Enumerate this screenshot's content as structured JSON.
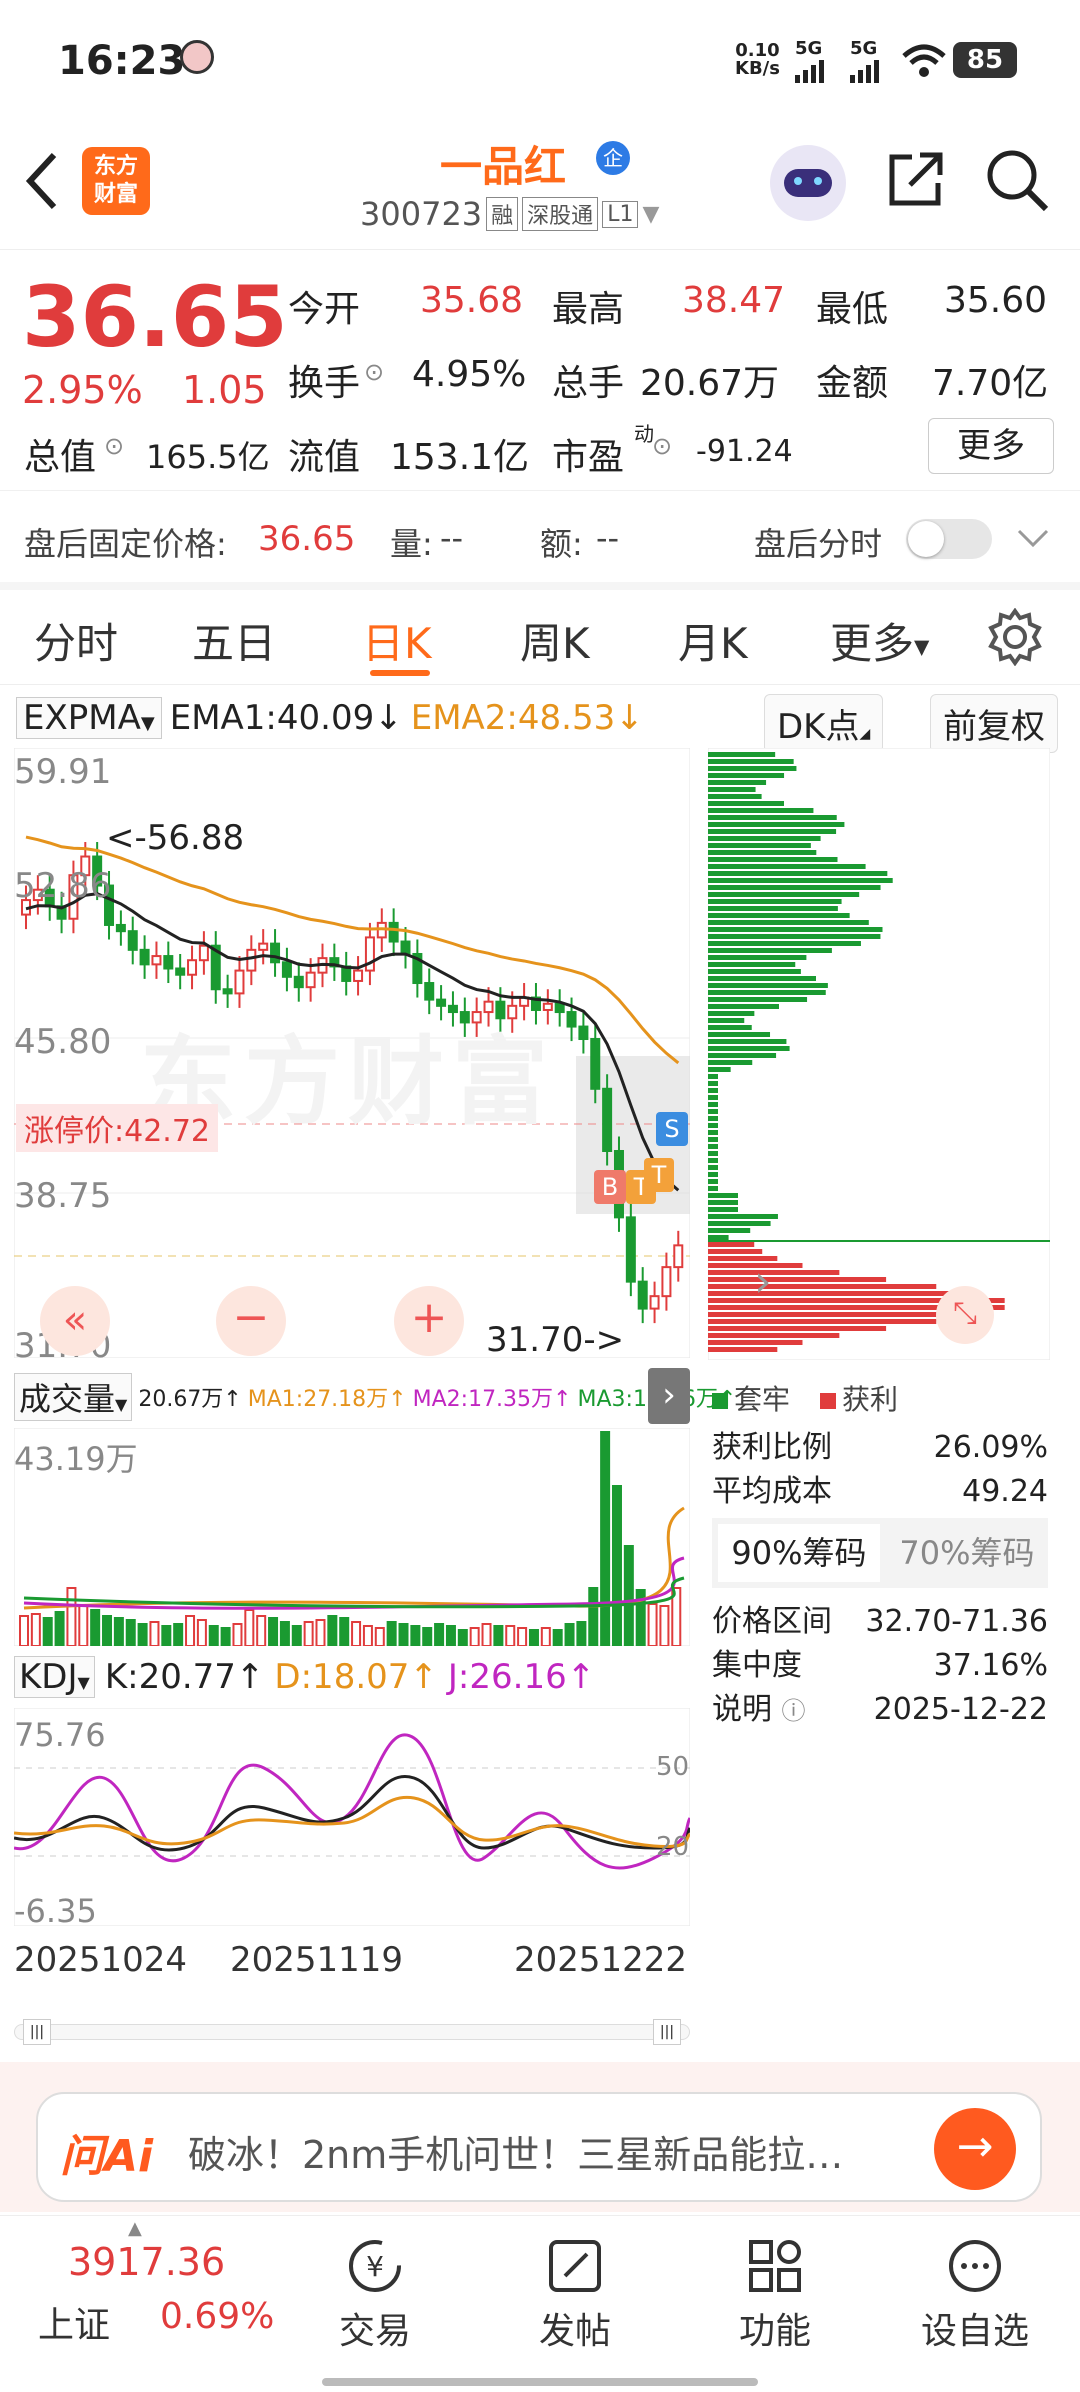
{
  "status_bar": {
    "time": "16:23",
    "net_speed_top": "0.10",
    "net_speed_bottom": "KB/s",
    "sig1": "5G",
    "sig2": "5G",
    "battery": "85"
  },
  "header": {
    "brand_line1": "东方",
    "brand_line2": "财富",
    "stock_name": "一品红",
    "stock_badge": "企",
    "code": "300723",
    "tag_rong": "融",
    "tag_connect": "深股通",
    "tag_level": "L1"
  },
  "quote": {
    "price": "36.65",
    "pct": "2.95%",
    "chg": "1.05",
    "open_label": "今开",
    "open": "35.68",
    "high_label": "最高",
    "high": "38.47",
    "low_label": "最低",
    "low": "35.60",
    "turnover_label": "换手",
    "turnover": "4.95%",
    "volume_label": "总手",
    "volume": "20.67万",
    "amount_label": "金额",
    "amount": "7.70亿",
    "mktcap_label": "总值",
    "mktcap": "165.5亿",
    "float_label": "流值",
    "float": "153.1亿",
    "pe_label": "市盈",
    "pe_sup": "动",
    "pe": "-91.24",
    "more": "更多"
  },
  "after_hours": {
    "price_label": "盘后固定价格:",
    "price": "36.65",
    "vol_label": "量:",
    "vol": "--",
    "amt_label": "额:",
    "amt": "--",
    "toggle_label": "盘后分时"
  },
  "tabs": [
    "分时",
    "五日",
    "日K",
    "周K",
    "月K",
    "更多"
  ],
  "chart_header": {
    "indicator": "EXPMA",
    "ema1": "EMA1:40.09",
    "ema2": "EMA2:48.53",
    "dk": "DK点",
    "adjust": "前复权"
  },
  "price_axis": {
    "top": "59.91",
    "y2": "52.86",
    "mid": "45.80",
    "y4": "38.75",
    "bottom": "31.70"
  },
  "annotations": {
    "high_mark": "<-56.88",
    "limit_up": "涨停价:42.72",
    "low_mark": "31.70->",
    "watermark": "东方财富",
    "b": "B",
    "t1": "T",
    "t2": "T",
    "s": "S"
  },
  "volume_header": {
    "label": "成交量",
    "v": "20.67万",
    "ma1": "MA1:27.18万",
    "ma2": "MA2:17.35万",
    "ma3": "MA3:13.06万",
    "max": "43.19万"
  },
  "kdj_header": {
    "label": "KDJ",
    "k": "K:20.77",
    "d": "D:18.07",
    "j": "J:26.16",
    "top": "75.76",
    "bottom": "-6.35",
    "l50": "50",
    "l20": "20"
  },
  "dates": [
    "20251024",
    "20251119",
    "20251222"
  ],
  "chip": {
    "legend_trap": "套牢",
    "legend_profit": "获利",
    "rows": [
      {
        "label": "获利比例",
        "value": "26.09%"
      },
      {
        "label": "平均成本",
        "value": "49.24"
      }
    ],
    "tab90": "90%筹码",
    "tab70": "70%筹码",
    "rows2": [
      {
        "label": "价格区间",
        "value": "32.70-71.36"
      },
      {
        "label": "集中度",
        "value": "37.16%"
      },
      {
        "label": "说明",
        "value": "2025-12-22"
      }
    ]
  },
  "ai": {
    "logo": "问Ai",
    "text": "破冰！2nm手机问世！三星新品能拉…"
  },
  "bottom_nav": {
    "index_value": "3917.36",
    "index_name": "上证",
    "index_pct": "0.69%",
    "trade": "交易",
    "post": "发帖",
    "func": "功能",
    "watch": "设自选"
  },
  "colors": {
    "up": "#e03c3c",
    "down": "#1a9a31",
    "ema2": "#e5931c",
    "accent": "#ff6a00"
  },
  "chart_data": {
    "type": "candlestick",
    "price_axis": [
      59.91,
      52.86,
      45.8,
      38.75,
      31.7
    ],
    "x_dates": [
      "20251024",
      "20251119",
      "20251222"
    ],
    "ema1": 40.09,
    "ema2": 48.53,
    "high_marker": 56.88,
    "low_marker": 31.7,
    "limit_up": 42.72,
    "volume_max": "43.19万",
    "kdj": {
      "k": 20.77,
      "d": 18.07,
      "j": 26.16,
      "range": [
        -6.35,
        75.76
      ]
    }
  }
}
